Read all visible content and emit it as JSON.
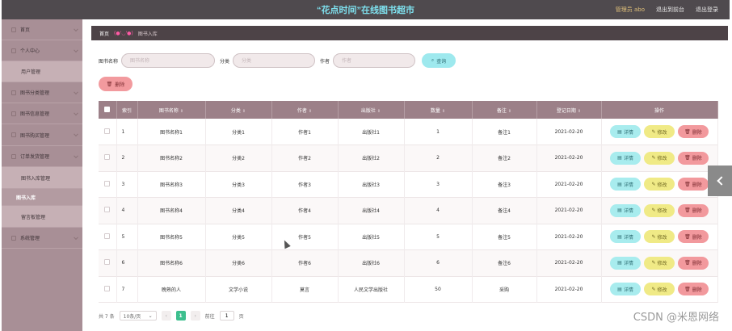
{
  "header": {
    "title": "“花点时间”在线图书超市",
    "user": "管理员 abo",
    "back_link": "退出到前台",
    "logout_link": "退出登录"
  },
  "sidebar": {
    "items": [
      {
        "label": "首页",
        "type": "top"
      },
      {
        "label": "个人中心",
        "type": "top"
      },
      {
        "label": "用户管理",
        "type": "sub"
      },
      {
        "label": "图书分类管理",
        "type": "top"
      },
      {
        "label": "图书信息管理",
        "type": "top"
      },
      {
        "label": "图书购买管理",
        "type": "top"
      },
      {
        "label": "订单发货管理",
        "type": "top"
      },
      {
        "label": "图书入库管理",
        "type": "sub"
      },
      {
        "label": "图书入库",
        "type": "sub-active"
      },
      {
        "label": "留言板管理",
        "type": "sub"
      },
      {
        "label": "系统管理",
        "type": "top"
      }
    ]
  },
  "breadcrumb": {
    "home": "首页",
    "emoticon": "(●'◡'●)",
    "current": "图书入库"
  },
  "search": {
    "name_label": "图书名称",
    "name_placeholder": "图书名称",
    "category_label": "分类",
    "category_placeholder": "分类",
    "author_label": "作者",
    "author_placeholder": "作者",
    "query_label": "查询",
    "delete_label": "删除"
  },
  "table": {
    "columns": [
      "索引",
      "图书名称",
      "分类",
      "作者",
      "出版社",
      "数量",
      "备注",
      "登记日期",
      "操作"
    ],
    "rows": [
      {
        "index": "1",
        "name": "图书名称1",
        "category": "分类1",
        "author": "作者1",
        "publisher": "出版社1",
        "qty": "1",
        "note": "备注1",
        "date": "2021-02-20"
      },
      {
        "index": "2",
        "name": "图书名称2",
        "category": "分类2",
        "author": "作者2",
        "publisher": "出版社2",
        "qty": "2",
        "note": "备注2",
        "date": "2021-02-20"
      },
      {
        "index": "3",
        "name": "图书名称3",
        "category": "分类3",
        "author": "作者3",
        "publisher": "出版社3",
        "qty": "3",
        "note": "备注3",
        "date": "2021-02-20"
      },
      {
        "index": "4",
        "name": "图书名称4",
        "category": "分类4",
        "author": "作者4",
        "publisher": "出版社4",
        "qty": "4",
        "note": "备注4",
        "date": "2021-02-20"
      },
      {
        "index": "5",
        "name": "图书名称5",
        "category": "分类5",
        "author": "作者5",
        "publisher": "出版社5",
        "qty": "5",
        "note": "备注5",
        "date": "2021-02-20"
      },
      {
        "index": "6",
        "name": "图书名称6",
        "category": "分类6",
        "author": "作者6",
        "publisher": "出版社6",
        "qty": "6",
        "note": "备注6",
        "date": "2021-02-20"
      },
      {
        "index": "7",
        "name": "晚熟的人",
        "category": "文学小说",
        "author": "莫言",
        "publisher": "人民文学出版社",
        "qty": "50",
        "note": "采购",
        "date": "2021-02-20"
      }
    ],
    "ops": {
      "detail": "详情",
      "edit": "修改",
      "delete": "删除"
    }
  },
  "pager": {
    "total": "共 7 条",
    "page_size": "10条/页",
    "current_page": "1",
    "goto_label": "前往",
    "goto_value": "1",
    "page_suffix": "页"
  },
  "watermark": "CSDN @米恩网络",
  "colors": {
    "header_bg": "#4f4a4e",
    "title": "#7ee0ee",
    "sidebar_bg": "#a88f96",
    "table_head": "#9c8088",
    "detail_btn": "#a8ecee",
    "edit_btn": "#f0ea86",
    "delete_btn": "#f2999d",
    "page_active": "#3dbf8e"
  }
}
